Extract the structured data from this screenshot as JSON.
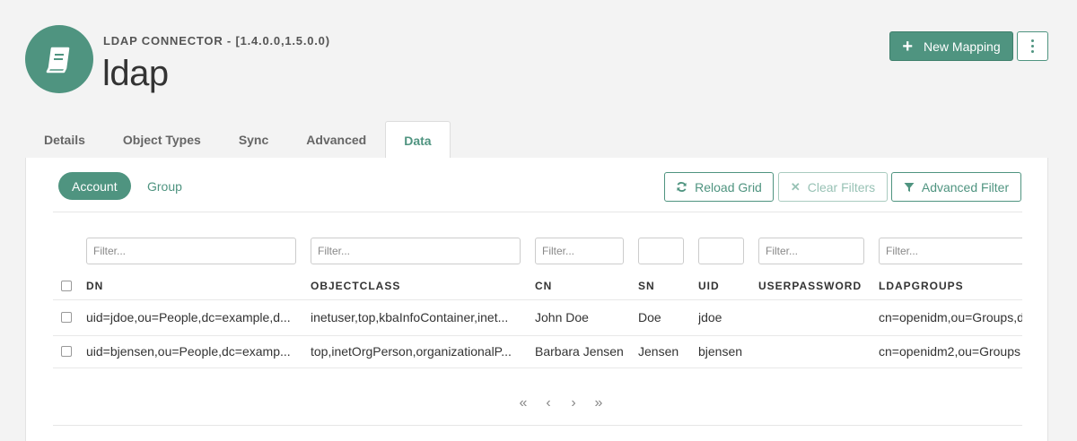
{
  "header": {
    "connector_label": "LDAP CONNECTOR - [1.4.0.0,1.5.0.0)",
    "title": "ldap",
    "new_mapping_label": "New Mapping",
    "avatar_icon": "book-icon",
    "accent_color": "#4f9480"
  },
  "tabs": [
    {
      "label": "Details"
    },
    {
      "label": "Object Types"
    },
    {
      "label": "Sync"
    },
    {
      "label": "Advanced"
    },
    {
      "label": "Data",
      "active": true
    }
  ],
  "object_type_pills": [
    {
      "label": "Account",
      "active": true
    },
    {
      "label": "Group"
    }
  ],
  "toolbar": {
    "reload_label": "Reload Grid",
    "clear_label": "Clear Filters",
    "advanced_label": "Advanced Filter"
  },
  "grid": {
    "filter_placeholder": "Filter...",
    "columns": [
      "DN",
      "OBJECTCLASS",
      "CN",
      "SN",
      "UID",
      "USERPASSWORD",
      "LDAPGROUPS"
    ],
    "rows": [
      {
        "dn": "uid=jdoe,ou=People,dc=example,d...",
        "objectclass": "inetuser,top,kbaInfoContainer,inet...",
        "cn": "John Doe",
        "sn": "Doe",
        "uid": "jdoe",
        "userpassword": "",
        "ldapgroups": "cn=openidm,ou=Groups,d"
      },
      {
        "dn": "uid=bjensen,ou=People,dc=examp...",
        "objectclass": "top,inetOrgPerson,organizationalP...",
        "cn": "Barbara Jensen",
        "sn": "Jensen",
        "uid": "bjensen",
        "userpassword": "",
        "ldapgroups": "cn=openidm2,ou=Groups"
      }
    ]
  },
  "pager": {
    "first": "«",
    "prev": "‹",
    "next": "›",
    "last": "»"
  }
}
